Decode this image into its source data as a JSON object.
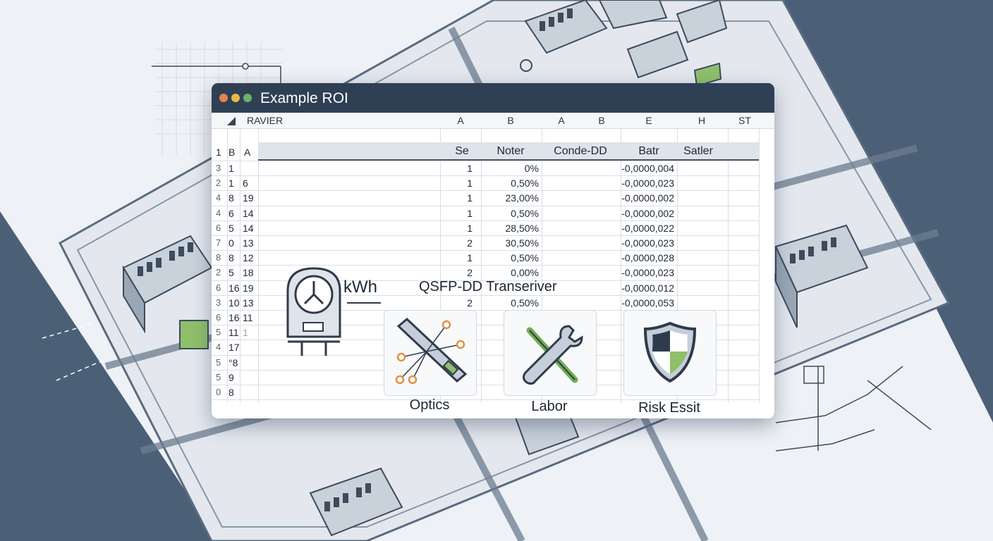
{
  "window": {
    "title": "Example ROI",
    "dots": [
      "#e8834a",
      "#e9b949",
      "#6cb36a"
    ]
  },
  "sheet": {
    "name": "RAVIER",
    "col_letters": [
      "A",
      "B",
      "A",
      "B",
      "E",
      "H",
      "ST"
    ],
    "index_headers": [
      "1",
      "B",
      "A"
    ],
    "headers": [
      "Se",
      "Noter",
      "Conde-DD",
      "Batr",
      "Satler"
    ],
    "rows": [
      {
        "n": "3",
        "b": "1",
        "a": "",
        "se": "1",
        "noter": "0%",
        "batr": "-0,0000,004"
      },
      {
        "n": "2",
        "b": "1",
        "a": "6",
        "se": "1",
        "noter": "0,50%",
        "batr": "-0,0000,023"
      },
      {
        "n": "4",
        "b": "8",
        "a": "19",
        "se": "1",
        "noter": "23,00%",
        "batr": "-0,0000,002"
      },
      {
        "n": "4",
        "b": "6",
        "a": "14",
        "se": "1",
        "noter": "0,50%",
        "batr": "-0,0000,002"
      },
      {
        "n": "6",
        "b": "5",
        "a": "14",
        "se": "1",
        "noter": "28,50%",
        "batr": "-0,0000,022"
      },
      {
        "n": "7",
        "b": "0",
        "a": "13",
        "se": "2",
        "noter": "30,50%",
        "batr": "-0,0000,023"
      },
      {
        "n": "8",
        "b": "8",
        "a": "12",
        "se": "1",
        "noter": "0,50%",
        "batr": "-0,0000,028"
      },
      {
        "n": "2",
        "b": "5",
        "a": "18",
        "se": "2",
        "noter": "0,00%",
        "batr": "-0,0000,023"
      },
      {
        "n": "6",
        "b": "16",
        "a": "19",
        "se": "",
        "noter": "",
        "batr": "-0,0000,012"
      },
      {
        "n": "3",
        "b": "10",
        "a": "13",
        "se": "2",
        "noter": "0,50%",
        "batr": "-0,0000,053"
      },
      {
        "n": "6",
        "b": "16",
        "a": "11",
        "se": "",
        "noter": "",
        "batr": ""
      },
      {
        "n": "5",
        "b": "11",
        "a": "1",
        "se": "",
        "noter": "",
        "batr": ""
      },
      {
        "n": "4",
        "b": "17",
        "a": "",
        "se": "",
        "noter": "",
        "batr": ""
      },
      {
        "n": "5",
        "b": "°8",
        "a": "",
        "se": "",
        "noter": "",
        "batr": ""
      },
      {
        "n": "5",
        "b": "9",
        "a": "",
        "se": "",
        "noter": "",
        "batr": ""
      },
      {
        "n": "0",
        "b": "8",
        "a": "",
        "se": "",
        "noter": "",
        "batr": ""
      }
    ]
  },
  "overlay": {
    "meter_unit": "kWh",
    "transceiver_label": "QSFP-DD Transeriver",
    "cards": [
      {
        "label": "Optics",
        "icon": "optical-transceiver-icon"
      },
      {
        "label": "Labor",
        "icon": "wrench-screwdriver-icon"
      },
      {
        "label": "Risk Essit",
        "icon": "shield-icon"
      }
    ]
  },
  "colors": {
    "titlebar": "#2f4055",
    "bg_dark": "#4b6077",
    "accent_green": "#8fbf6b"
  }
}
